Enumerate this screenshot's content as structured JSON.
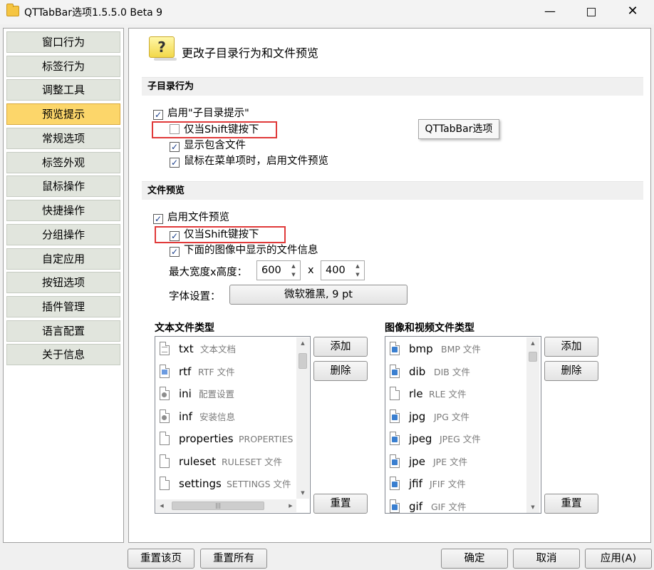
{
  "window": {
    "title": "QTTabBar选项1.5.5.0 Beta 9"
  },
  "sidebar": {
    "items": [
      "窗口行为",
      "标签行为",
      "调整工具",
      "预览提示",
      "常规选项",
      "标签外观",
      "鼠标操作",
      "快捷操作",
      "分组操作",
      "自定应用",
      "按钮选项",
      "插件管理",
      "语言配置",
      "关于信息"
    ],
    "active_index": 3
  },
  "main": {
    "page_title": "更改子目录行为和文件预览",
    "subdir_section": {
      "title": "子目录行为",
      "enable_tips": {
        "label": "启用\"子目录提示\"",
        "checked": true
      },
      "shift_only": {
        "label": "仅当Shift键按下",
        "checked": false
      },
      "show_files": {
        "label": "显示包含文件",
        "checked": true
      },
      "menu_preview": {
        "label": "鼠标在菜单项时，启用文件预览",
        "checked": true
      }
    },
    "tooltip": "QTTabBar选项",
    "preview_section": {
      "title": "文件预览",
      "enable_preview": {
        "label": "启用文件预览",
        "checked": true
      },
      "shift_only": {
        "label": "仅当Shift键按下",
        "checked": true
      },
      "show_info": {
        "label": "下面的图像中显示的文件信息",
        "checked": true
      },
      "size_label": "最大宽度x高度：",
      "width": "600",
      "times": "x",
      "height": "400",
      "font_label": "字体设置：",
      "font_value": "微软雅黑, 9 pt"
    },
    "text_types": {
      "title": "文本文件类型",
      "items": [
        {
          "ext": "txt",
          "desc": "文本文档",
          "icon": "doc"
        },
        {
          "ext": "rtf",
          "desc": "RTF 文件",
          "icon": "rtf"
        },
        {
          "ext": "ini",
          "desc": "配置设置",
          "icon": "set"
        },
        {
          "ext": "inf",
          "desc": "安装信息",
          "icon": "set"
        },
        {
          "ext": "properties",
          "desc": "PROPERTIES",
          "icon": "blank"
        },
        {
          "ext": "ruleset",
          "desc": "RULESET 文件",
          "icon": "blank"
        },
        {
          "ext": "settings",
          "desc": "SETTINGS 文件",
          "icon": "blank"
        }
      ],
      "add_label": "添加",
      "delete_label": "删除",
      "reset_label": "重置"
    },
    "image_types": {
      "title": "图像和视频文件类型",
      "items": [
        {
          "ext": "bmp",
          "desc": "BMP 文件",
          "icon": "img"
        },
        {
          "ext": "dib",
          "desc": "DIB 文件",
          "icon": "img"
        },
        {
          "ext": "rle",
          "desc": "RLE 文件",
          "icon": "blank"
        },
        {
          "ext": "jpg",
          "desc": "JPG 文件",
          "icon": "img"
        },
        {
          "ext": "jpeg",
          "desc": "JPEG 文件",
          "icon": "img"
        },
        {
          "ext": "jpe",
          "desc": "JPE 文件",
          "icon": "img"
        },
        {
          "ext": "jfif",
          "desc": "JFIF 文件",
          "icon": "img"
        },
        {
          "ext": "gif",
          "desc": "GIF 文件",
          "icon": "img"
        }
      ],
      "add_label": "添加",
      "delete_label": "删除",
      "reset_label": "重置"
    }
  },
  "footer": {
    "reset_page": "重置该页",
    "reset_all": "重置所有",
    "ok": "确定",
    "cancel": "取消",
    "apply": "应用(A)"
  }
}
